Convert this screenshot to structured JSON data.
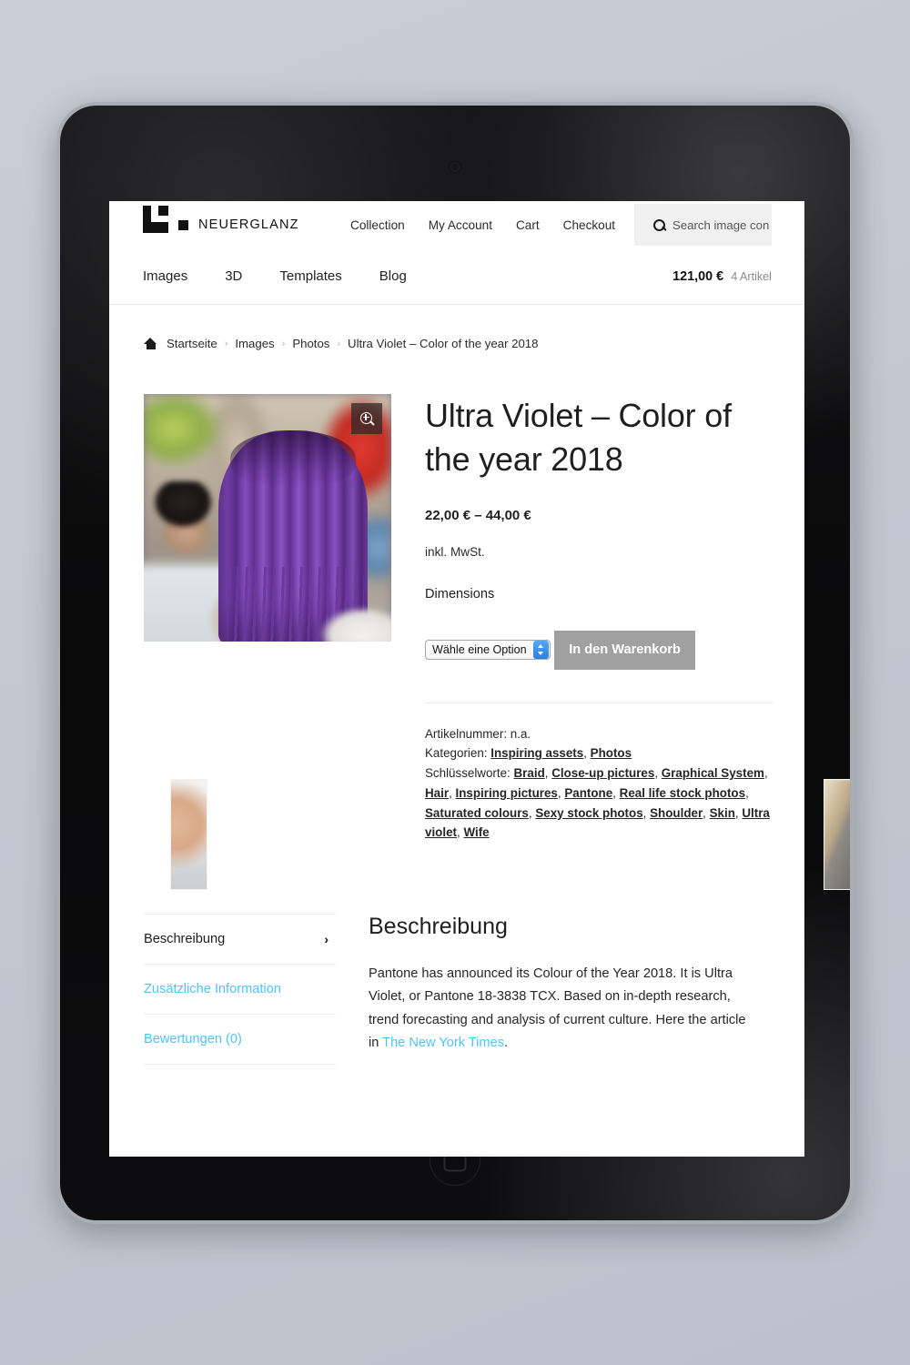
{
  "header": {
    "logo_word": "NEUERGLANZ",
    "top_nav": [
      "Collection",
      "My Account",
      "Cart",
      "Checkout"
    ],
    "search": {
      "icon": "search-icon",
      "placeholder": "Search image con"
    },
    "main_nav": [
      "Images",
      "3D",
      "Templates",
      "Blog"
    ],
    "cart": {
      "total": "121,00 €",
      "count": "4 Artikel"
    }
  },
  "breadcrumb": {
    "home_icon": "home-icon",
    "items": [
      "Startseite",
      "Images",
      "Photos",
      "Ultra Violet – Color of the year 2018"
    ],
    "separator": "›"
  },
  "product": {
    "gallery": {
      "zoom_icon": "magnifier-plus-icon"
    },
    "title": "Ultra Violet – Color of the year 2018",
    "price": "22,00 € – 44,00 €",
    "tax_note": "inkl. MwSt.",
    "option_label": "Dimensions",
    "option_value": "Wähle eine Option",
    "add_to_cart": "In den Warenkorb",
    "meta": {
      "sku_label": "Artikelnummer:",
      "sku_value": "n.a.",
      "categories_label": "Kategorien:",
      "categories": [
        "Inspiring assets",
        "Photos"
      ],
      "tags_label": "Schlüsselworte:",
      "tags": [
        "Braid",
        "Close-up pictures",
        "Graphical System",
        "Hair",
        "Inspiring pictures",
        "Pantone",
        "Real life stock photos",
        "Saturated colours",
        "Sexy stock photos",
        "Shoulder",
        "Skin",
        "Ultra violet",
        "Wife"
      ]
    }
  },
  "tabs": {
    "items": [
      {
        "label": "Beschreibung",
        "active": true,
        "chevron": "›"
      },
      {
        "label": "Zusätzliche Information",
        "active": false
      },
      {
        "label": "Bewertungen (0)",
        "active": false
      }
    ],
    "panel": {
      "heading": "Beschreibung",
      "body_1": "Pantone has announced its Colour of the Year 2018. It is Ultra Violet, or Pantone 18-3838 TCX. Based on in-depth research, trend forecasting and analysis of current culture. Here the article in ",
      "link": "The New York Times",
      "body_2": "."
    }
  },
  "colors": {
    "link_blue": "#4fc3f7",
    "button_grey": "#a0a0a0",
    "page_bg": "#c3c8d1",
    "select_blue": "#2b7fe0"
  }
}
